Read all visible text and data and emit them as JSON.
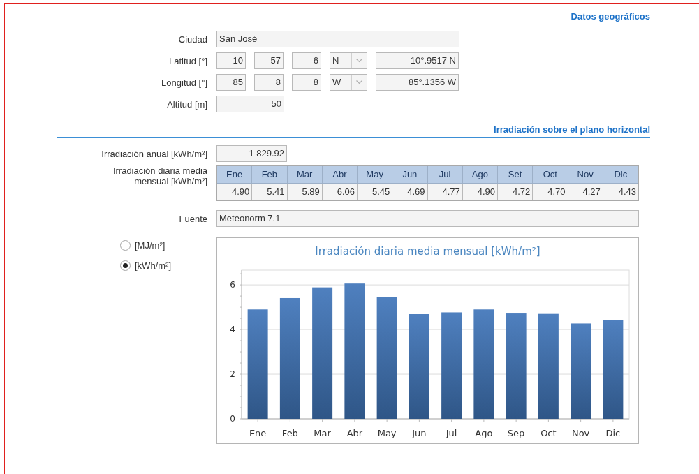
{
  "geo": {
    "title": "Datos geográficos",
    "city": {
      "label": "Ciudad",
      "value": "San José"
    },
    "latitude": {
      "label": "Latitud [°]",
      "degrees": "10",
      "minutes": "57",
      "seconds": "6",
      "hemisphere": "N",
      "decimal": "10°.9517 N"
    },
    "longitude": {
      "label": "Longitud [°]",
      "degrees": "85",
      "minutes": "8",
      "seconds": "8",
      "hemisphere": "W",
      "decimal": "85°.1356 W"
    },
    "altitude": {
      "label": "Altitud [m]",
      "value": "50"
    }
  },
  "irradiation": {
    "title": "Irradiación sobre el plano horizontal",
    "annual": {
      "label": "Irradiación anual [kWh/m²]",
      "value": "1 829.92"
    },
    "monthly": {
      "label": "Irradiación diaria media mensual [kWh/m²]",
      "months": [
        "Ene",
        "Feb",
        "Mar",
        "Abr",
        "May",
        "Jun",
        "Jul",
        "Ago",
        "Set",
        "Oct",
        "Nov",
        "Dic"
      ],
      "values": [
        "4.90",
        "5.41",
        "5.89",
        "6.06",
        "5.45",
        "4.69",
        "4.77",
        "4.90",
        "4.72",
        "4.70",
        "4.27",
        "4.43"
      ]
    },
    "source": {
      "label": "Fuente",
      "value": "Meteonorm 7.1"
    },
    "units": [
      {
        "label": "[MJ/m²]",
        "selected": false
      },
      {
        "label": "[kWh/m²]",
        "selected": true
      }
    ],
    "chart": {
      "chart_data": {
        "type": "bar",
        "title": "Irradiación diaria media mensual [kWh/m²]",
        "categories": [
          "Ene",
          "Feb",
          "Mar",
          "Abr",
          "May",
          "Jun",
          "Jul",
          "Ago",
          "Sep",
          "Oct",
          "Nov",
          "Dic"
        ],
        "values": [
          4.9,
          5.41,
          5.89,
          6.06,
          5.45,
          4.69,
          4.77,
          4.9,
          4.72,
          4.7,
          4.27,
          4.43
        ],
        "ylim": [
          0,
          6.66
        ],
        "yticks": [
          0,
          2,
          4,
          6
        ],
        "grid": true
      }
    }
  }
}
